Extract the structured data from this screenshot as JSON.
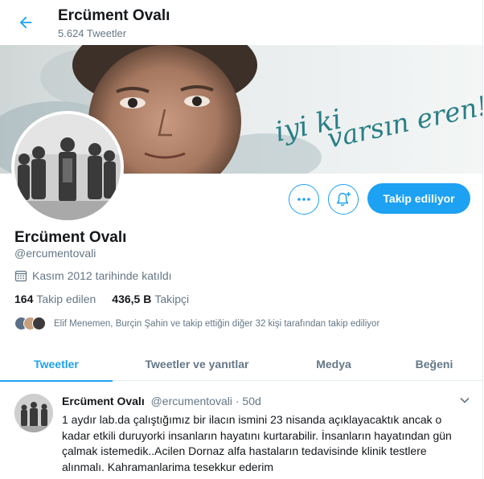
{
  "header": {
    "title": "Ercüment Ovalı",
    "tweet_count": "5.624 Tweetler"
  },
  "banner": {
    "text_line1": "iyi ki",
    "text_line2": "varsın eren!",
    "accent_color": "#2a7f86"
  },
  "actions": {
    "more_icon": "more-icon",
    "notify_icon": "bell-plus-icon",
    "follow_label": "Takip ediliyor"
  },
  "profile": {
    "name": "Ercüment Ovalı",
    "handle": "@ercumentovali",
    "joined": "Kasım 2012 tarihinde katıldı",
    "following_count": "164",
    "following_label": "Takip edilen",
    "followers_count": "436,5 B",
    "followers_label": "Takipçi",
    "known_followers": "Elif Menemen, Burçin Şahin ve takip ettiğin diğer 32 kişi tarafından takip ediliyor"
  },
  "tabs": [
    {
      "label": "Tweetler",
      "active": true
    },
    {
      "label": "Tweetler ve yanıtlar",
      "active": false
    },
    {
      "label": "Medya",
      "active": false
    },
    {
      "label": "Beğeni",
      "active": false
    }
  ],
  "tweet": {
    "name": "Ercüment Ovalı",
    "handle": "@ercumentovali",
    "separator": "·",
    "time": "50d",
    "text": "1 aydır lab.da çalıştığımız bir ilacın ismini 23 nisanda açıklayacaktık ancak o kadar etkili duruyorki insanların hayatını kurtarabilir.  İnsanların hayatından gün çalmak istemedik..Acilen Dornaz alfa hastaların tedavisinde klinik testlere alınmalı. Kahramanlarima tesekkur ederim"
  },
  "colors": {
    "accent": "#1da1f2",
    "secondary_text": "#657786",
    "primary_text": "#14171a"
  }
}
